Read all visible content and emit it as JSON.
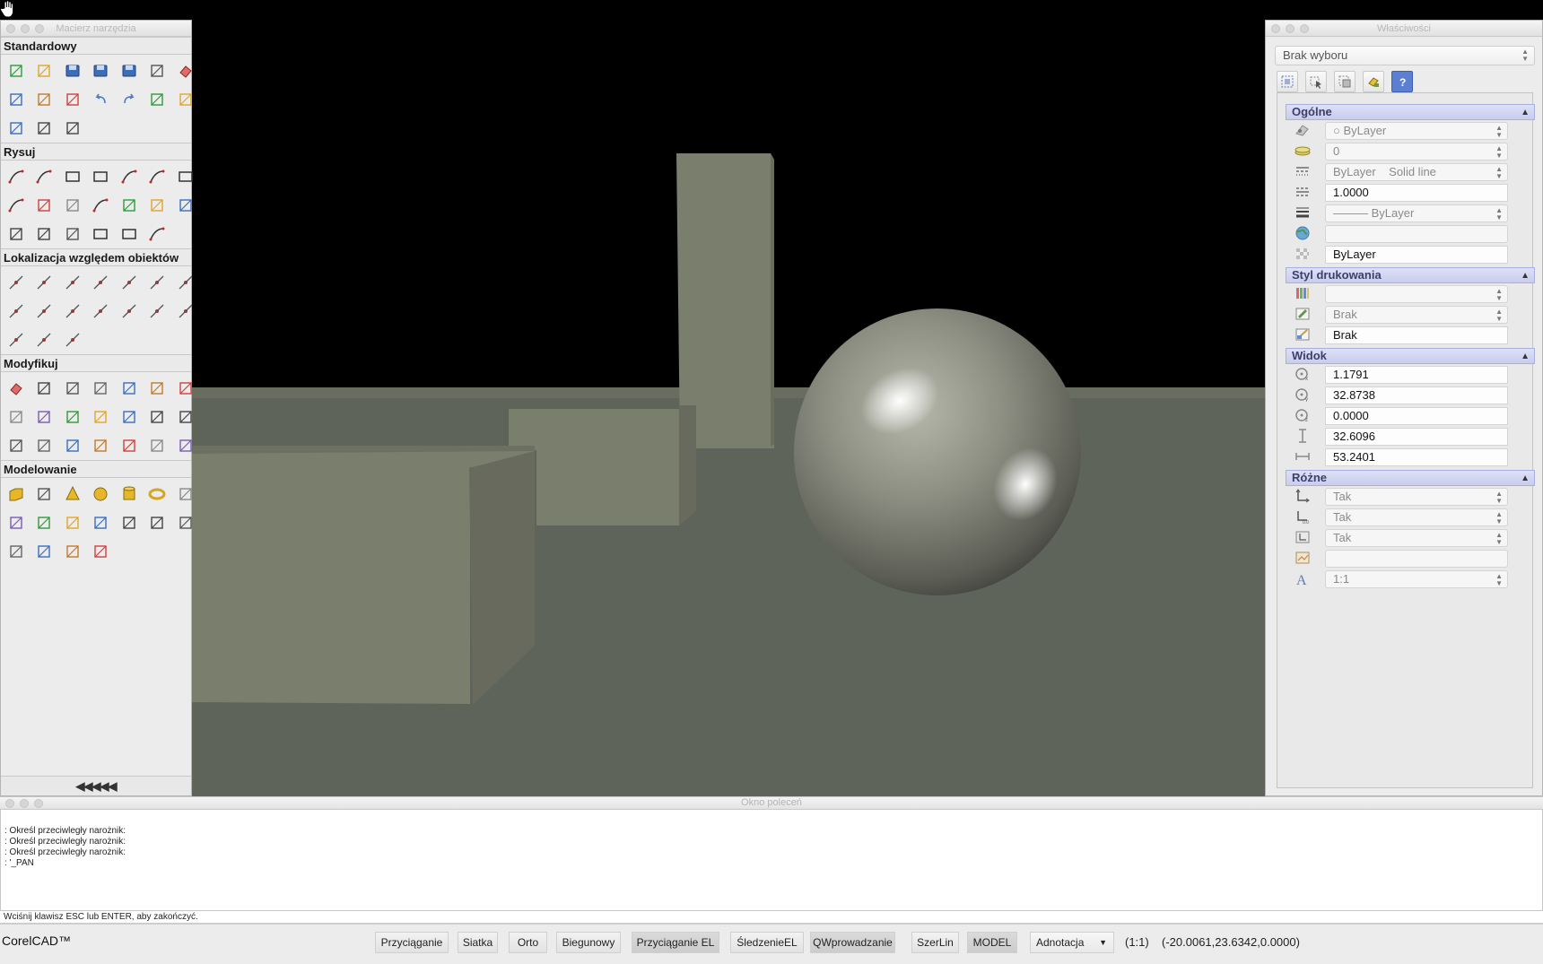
{
  "toolbox": {
    "title": "Macierz narzędzia",
    "sections": [
      {
        "title": "Standardowy"
      },
      {
        "title": "Rysuj"
      },
      {
        "title": "Lokalizacja względem obiektów"
      },
      {
        "title": "Modyfikuj"
      },
      {
        "title": "Modelowanie"
      }
    ],
    "collapse_label": "◀◀◀◀◀"
  },
  "properties": {
    "title": "Właściwości",
    "selection": "Brak wyboru",
    "sections": {
      "general": "Ogólne",
      "print_style": "Styl drukowania",
      "view": "Widok",
      "misc": "Różne"
    },
    "general": {
      "color": "ByLayer",
      "layer": "0",
      "linetype_a": "ByLayer",
      "linetype_b": "Solid line",
      "linetype_scale": "1.0000",
      "lineweight": "——— ByLayer",
      "hyperlink": "",
      "transparency": "ByLayer"
    },
    "print_style": {
      "style": "",
      "table": "Brak",
      "attached": "Brak"
    },
    "view": {
      "center_x": "1.1791",
      "center_y": "32.8738",
      "center_z": "0.0000",
      "height": "32.6096",
      "width": "53.2401"
    },
    "misc": {
      "ucs_on": "Tak",
      "ucs_at_origin": "Tak",
      "ucs_per_viewport": "Tak",
      "ucs_name": "",
      "annotation_scale": "1:1"
    }
  },
  "command": {
    "title": "Okno poleceń",
    "history": [
      ": Określ przeciwległy narożnik:",
      ": Określ przeciwległy narożnik:",
      ": Określ przeciwległy narożnik:",
      ": '_PAN"
    ],
    "prompt": "Wciśnij klawisz ESC lub ENTER, aby zakończyć."
  },
  "status": {
    "app_name": "CorelCAD™",
    "buttons": [
      {
        "label": "Przyciąganie",
        "on": false
      },
      {
        "label": "Siatka",
        "on": false
      },
      {
        "label": "Orto",
        "on": false
      },
      {
        "label": "Biegunowy",
        "on": false
      },
      {
        "label": "Przyciąganie EL",
        "on": true
      },
      {
        "label": "ŚledzenieEL",
        "on": false
      },
      {
        "label": "QWprowadzanie",
        "on": true
      },
      {
        "label": "SzerLin",
        "on": false
      },
      {
        "label": "MODEL",
        "on": true
      }
    ],
    "annotation": "Adnotacja",
    "scale": "(1:1)",
    "coords": "(-20.0061,23.6342,0.0000)"
  },
  "colors": {
    "floor": "#5f645a",
    "box": "#797d6c",
    "section_header": "#c9ccec"
  }
}
